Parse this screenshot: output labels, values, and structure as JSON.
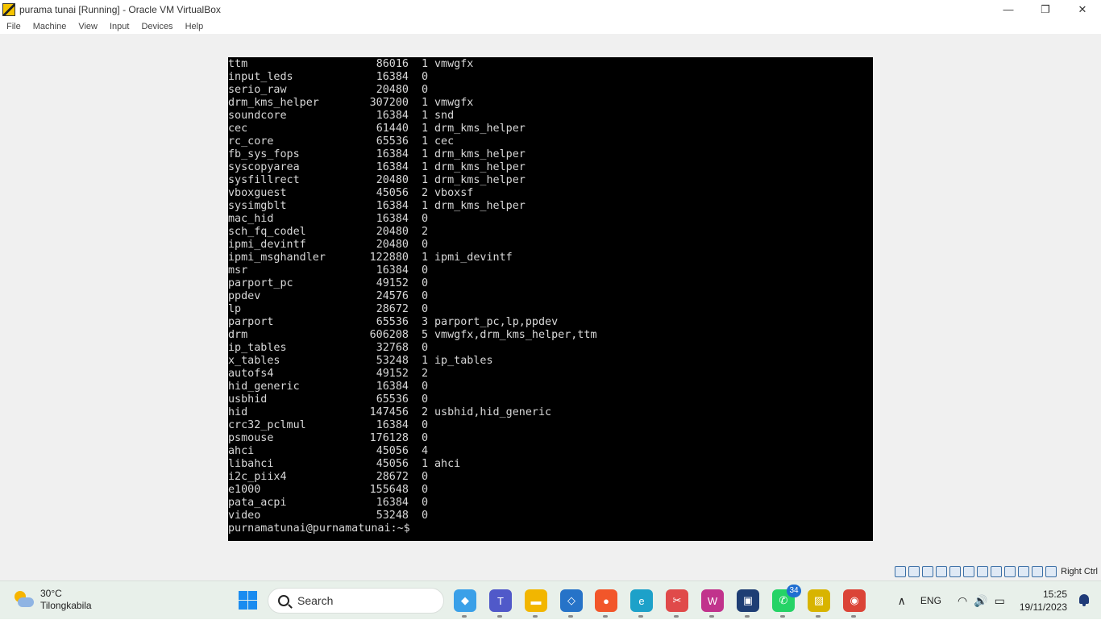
{
  "window": {
    "title": "purama tunai [Running] - Oracle VM VirtualBox",
    "controls": {
      "minimize": "—",
      "restore": "❐",
      "close": "✕"
    }
  },
  "menu": [
    "File",
    "Machine",
    "View",
    "Input",
    "Devices",
    "Help"
  ],
  "console": {
    "rows": [
      {
        "name": "ttm",
        "size": "86016",
        "used": "1",
        "by": "vmwgfx"
      },
      {
        "name": "input_leds",
        "size": "16384",
        "used": "0",
        "by": ""
      },
      {
        "name": "serio_raw",
        "size": "20480",
        "used": "0",
        "by": ""
      },
      {
        "name": "drm_kms_helper",
        "size": "307200",
        "used": "1",
        "by": "vmwgfx"
      },
      {
        "name": "soundcore",
        "size": "16384",
        "used": "1",
        "by": "snd"
      },
      {
        "name": "cec",
        "size": "61440",
        "used": "1",
        "by": "drm_kms_helper"
      },
      {
        "name": "rc_core",
        "size": "65536",
        "used": "1",
        "by": "cec"
      },
      {
        "name": "fb_sys_fops",
        "size": "16384",
        "used": "1",
        "by": "drm_kms_helper"
      },
      {
        "name": "syscopyarea",
        "size": "16384",
        "used": "1",
        "by": "drm_kms_helper"
      },
      {
        "name": "sysfillrect",
        "size": "20480",
        "used": "1",
        "by": "drm_kms_helper"
      },
      {
        "name": "vboxguest",
        "size": "45056",
        "used": "2",
        "by": "vboxsf"
      },
      {
        "name": "sysimgblt",
        "size": "16384",
        "used": "1",
        "by": "drm_kms_helper"
      },
      {
        "name": "mac_hid",
        "size": "16384",
        "used": "0",
        "by": ""
      },
      {
        "name": "sch_fq_codel",
        "size": "20480",
        "used": "2",
        "by": ""
      },
      {
        "name": "ipmi_devintf",
        "size": "20480",
        "used": "0",
        "by": ""
      },
      {
        "name": "ipmi_msghandler",
        "size": "122880",
        "used": "1",
        "by": "ipmi_devintf"
      },
      {
        "name": "msr",
        "size": "16384",
        "used": "0",
        "by": ""
      },
      {
        "name": "parport_pc",
        "size": "49152",
        "used": "0",
        "by": ""
      },
      {
        "name": "ppdev",
        "size": "24576",
        "used": "0",
        "by": ""
      },
      {
        "name": "lp",
        "size": "28672",
        "used": "0",
        "by": ""
      },
      {
        "name": "parport",
        "size": "65536",
        "used": "3",
        "by": "parport_pc,lp,ppdev"
      },
      {
        "name": "drm",
        "size": "606208",
        "used": "5",
        "by": "vmwgfx,drm_kms_helper,ttm"
      },
      {
        "name": "ip_tables",
        "size": "32768",
        "used": "0",
        "by": ""
      },
      {
        "name": "x_tables",
        "size": "53248",
        "used": "1",
        "by": "ip_tables"
      },
      {
        "name": "autofs4",
        "size": "49152",
        "used": "2",
        "by": ""
      },
      {
        "name": "hid_generic",
        "size": "16384",
        "used": "0",
        "by": ""
      },
      {
        "name": "usbhid",
        "size": "65536",
        "used": "0",
        "by": ""
      },
      {
        "name": "hid",
        "size": "147456",
        "used": "2",
        "by": "usbhid,hid_generic"
      },
      {
        "name": "crc32_pclmul",
        "size": "16384",
        "used": "0",
        "by": ""
      },
      {
        "name": "psmouse",
        "size": "176128",
        "used": "0",
        "by": ""
      },
      {
        "name": "ahci",
        "size": "45056",
        "used": "4",
        "by": ""
      },
      {
        "name": "libahci",
        "size": "45056",
        "used": "1",
        "by": "ahci"
      },
      {
        "name": "i2c_piix4",
        "size": "28672",
        "used": "0",
        "by": ""
      },
      {
        "name": "e1000",
        "size": "155648",
        "used": "0",
        "by": ""
      },
      {
        "name": "pata_acpi",
        "size": "16384",
        "used": "0",
        "by": ""
      },
      {
        "name": "video",
        "size": "53248",
        "used": "0",
        "by": ""
      }
    ],
    "prompt": "purnamatunai@purnamatunai:~$"
  },
  "statusbar": {
    "host_key": "Right Ctrl",
    "icons": [
      "hard-disk-icon",
      "optical-drive-icon",
      "audio-icon",
      "network-icon",
      "usb-icon",
      "shared-folders-icon",
      "display-icon",
      "recording-icon",
      "video-capture-icon",
      "cpu-icon",
      "mouse-integration-icon",
      "keyboard-icon"
    ]
  },
  "taskbar": {
    "weather": {
      "temp": "30°C",
      "location": "Tilongkabila"
    },
    "search_label": "Search",
    "apps": [
      {
        "name": "copilot-app",
        "glyph": "◆",
        "color": "#3aa0e8",
        "badge": ""
      },
      {
        "name": "teams-app",
        "glyph": "T",
        "color": "#5059c9",
        "badge": ""
      },
      {
        "name": "file-explorer-app",
        "glyph": "▬",
        "color": "#f2b600",
        "badge": ""
      },
      {
        "name": "vscode-app",
        "glyph": "◇",
        "color": "#2673c8",
        "badge": ""
      },
      {
        "name": "firefox-app",
        "glyph": "●",
        "color": "#f2562a",
        "badge": ""
      },
      {
        "name": "edge-app",
        "glyph": "e",
        "color": "#1da1c9",
        "badge": ""
      },
      {
        "name": "snipping-tool-app",
        "glyph": "✂",
        "color": "#e04a4a",
        "badge": ""
      },
      {
        "name": "wps-app",
        "glyph": "W",
        "color": "#c1338c",
        "badge": ""
      },
      {
        "name": "virtualbox-app",
        "glyph": "▣",
        "color": "#1e3e74",
        "badge": ""
      },
      {
        "name": "whatsapp-app",
        "glyph": "✆",
        "color": "#25d366",
        "badge": "34"
      },
      {
        "name": "vm-window-app",
        "glyph": "▨",
        "color": "#d8b400",
        "badge": ""
      },
      {
        "name": "chrome-app",
        "glyph": "◉",
        "color": "#db4437",
        "badge": ""
      }
    ],
    "tray": {
      "chevron": "∧",
      "language": "ENG",
      "wifi": "◠",
      "volume": "🔊",
      "battery": "▭",
      "time": "15:25",
      "date": "19/11/2023"
    }
  }
}
